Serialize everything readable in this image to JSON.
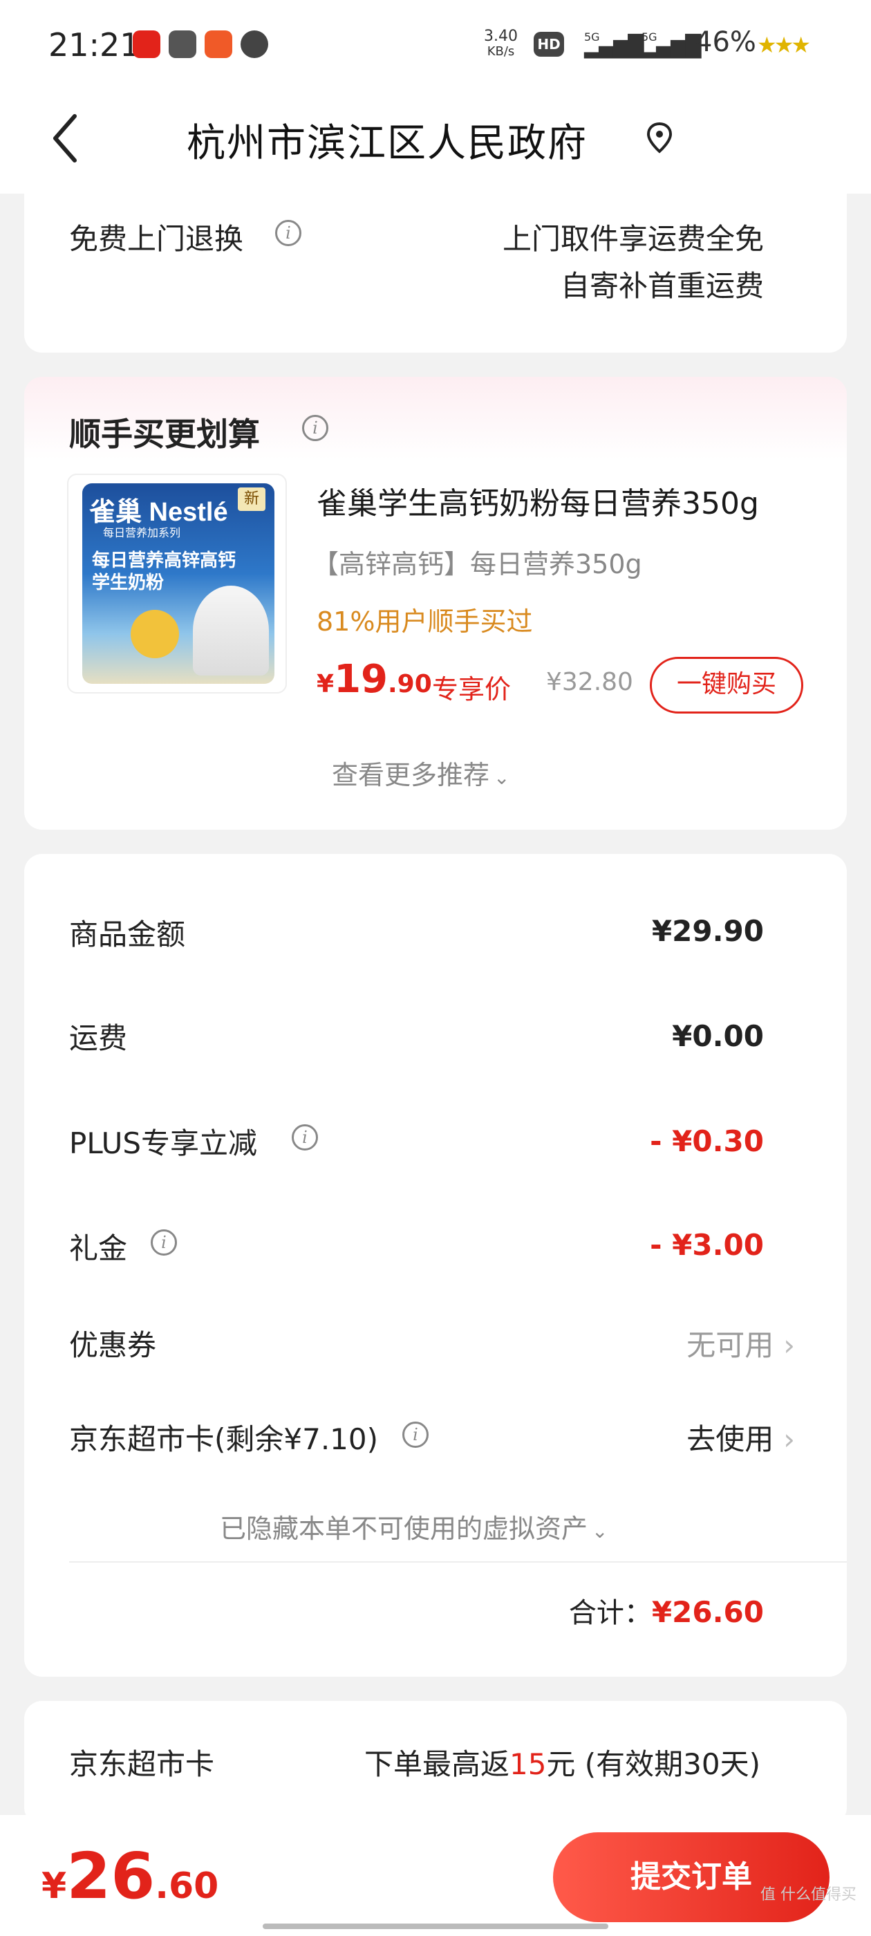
{
  "status_bar": {
    "time": "21:21",
    "speed": "3.40",
    "speed_unit": "KB/s",
    "hd": "HD",
    "sim1": "5G",
    "sim2": "5G",
    "battery": "46%",
    "icons": [
      "netease-music-icon",
      "app-icon",
      "app-icon",
      "link-icon"
    ]
  },
  "nav": {
    "title": "杭州市滨江区人民政府",
    "back_icon": "chevron-left-icon",
    "location_icon": "location-pin-icon"
  },
  "return_section": {
    "label": "免费上门退换",
    "line1": "上门取件享运费全免",
    "line2": "自寄补首重运费"
  },
  "recommend": {
    "title": "顺手买更划算",
    "product": {
      "name": "雀巢学生高钙奶粉每日营养350g",
      "spec": "【高锌高钙】每日营养350g",
      "social_proof": "81%用户顺手买过",
      "price_symbol": "¥",
      "price_int": "19",
      "price_dec": ".90",
      "price_tag": "专享价",
      "original_price": "¥32.80",
      "buy_button": "一键购买",
      "image_brand": "雀巢 Nestlé",
      "image_series": "每日营养加系列",
      "image_title": "每日营养高锌高钙\n学生奶粉",
      "image_badge": "新"
    },
    "more": "查看更多推荐"
  },
  "summary": {
    "rows": [
      {
        "label": "商品金额",
        "value": "¥29.90"
      },
      {
        "label": "运费",
        "value": "¥0.00"
      },
      {
        "label": "PLUS专享立减",
        "value": "- ¥0.30"
      },
      {
        "label": "礼金",
        "value": "- ¥3.00"
      },
      {
        "label": "优惠券",
        "value": "无可用"
      },
      {
        "label": "京东超市卡(剩余¥7.10)",
        "value": "去使用"
      }
    ],
    "hidden_assets": "已隐藏本单不可使用的虚拟资产",
    "total_label": "合计：",
    "total_value": "¥26.60"
  },
  "jd_card": {
    "label": "京东超市卡",
    "promo_prefix": "下单最高返",
    "promo_amount": "15",
    "promo_suffix": "元 (有效期30天)"
  },
  "footer": {
    "price_symbol": "¥",
    "price_int": "26",
    "price_dec": ".60",
    "submit": "提交订单",
    "watermark": "值 什么值得买"
  },
  "colors": {
    "accent": "#e2231a",
    "orange": "#d98a1f",
    "background": "#f2f2f2"
  }
}
